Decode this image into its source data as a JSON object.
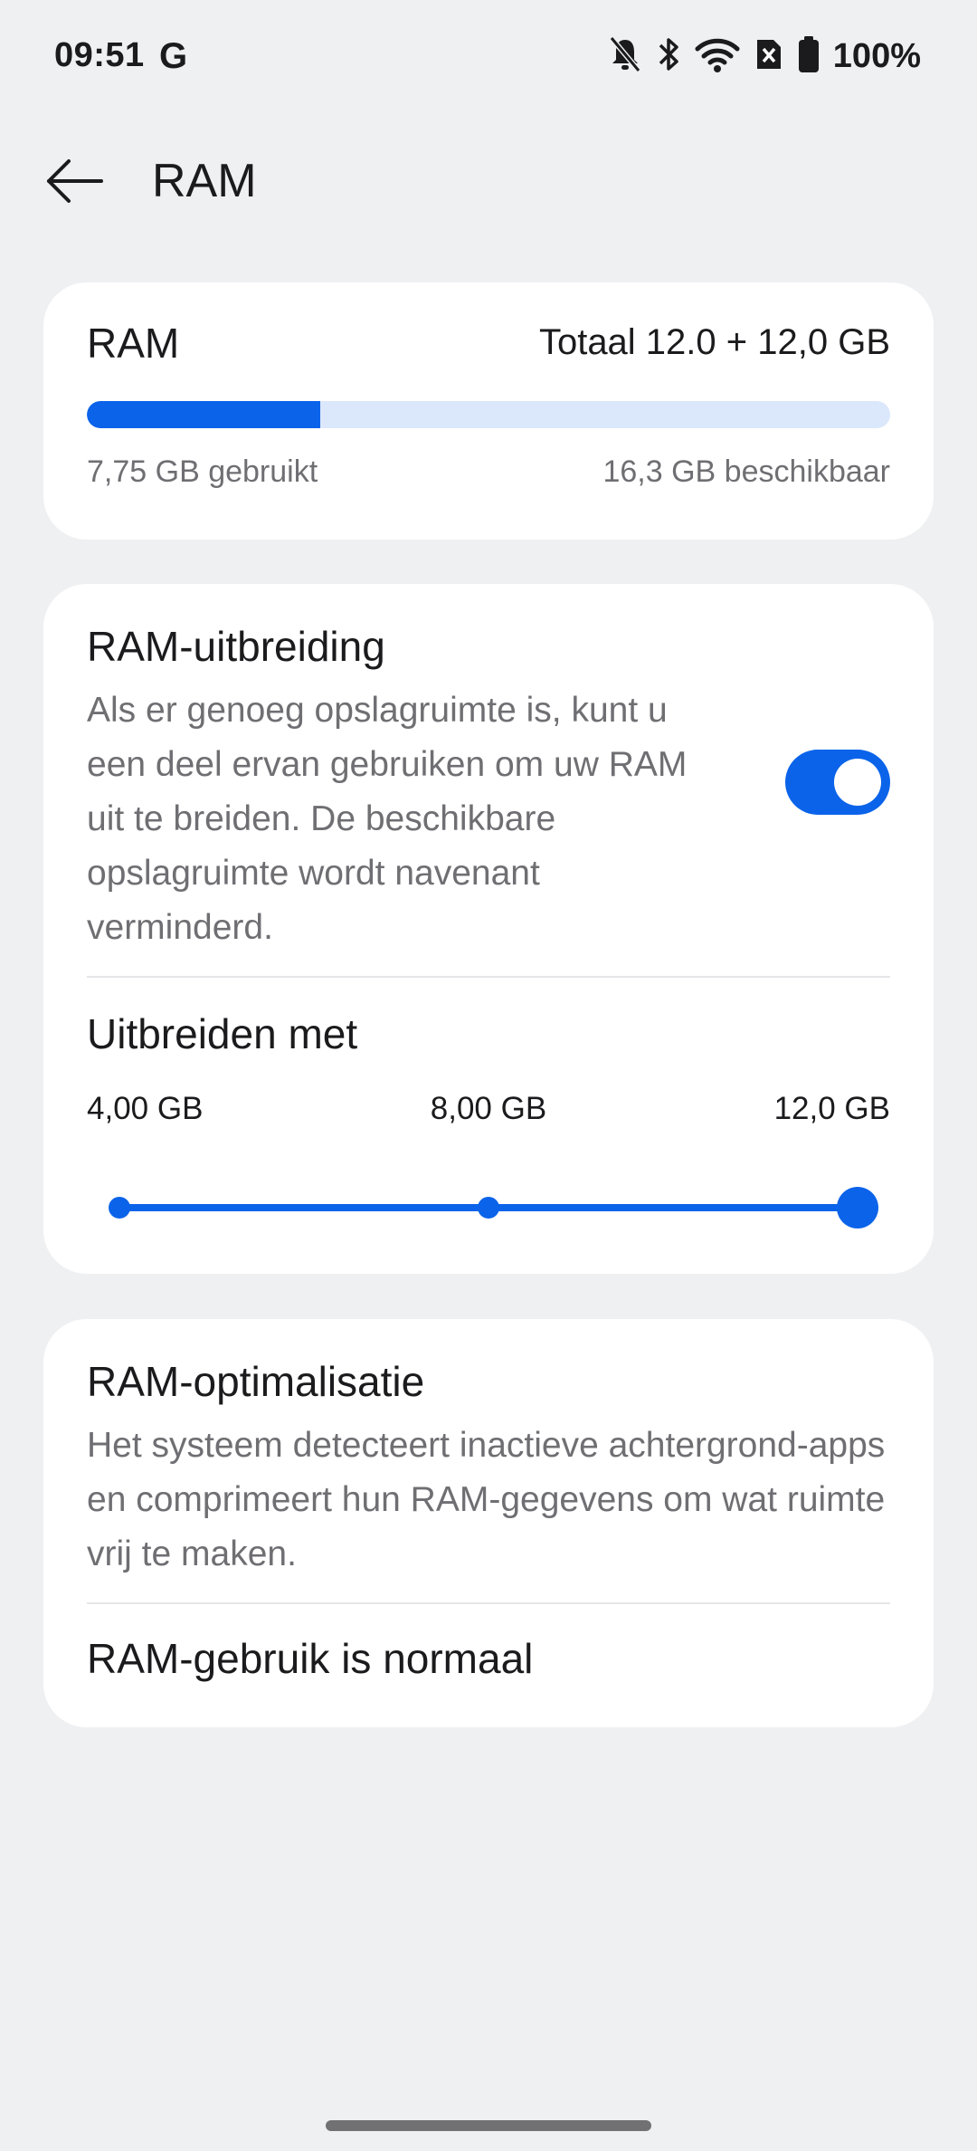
{
  "status_bar": {
    "time": "09:51",
    "google_icon_text": "G",
    "battery_text": "100%",
    "icons": [
      "bell-muted-icon",
      "bluetooth-icon",
      "wifi-icon",
      "no-sim-icon",
      "battery-icon"
    ]
  },
  "header": {
    "title": "RAM",
    "back_icon": "arrow-left-icon"
  },
  "ram_card": {
    "title": "RAM",
    "total": "Totaal 12.0 + 12,0 GB",
    "used": "7,75 GB gebruikt",
    "available": "16,3 GB beschikbaar",
    "usage_fraction": 0.29
  },
  "extension_card": {
    "title": "RAM-uitbreiding",
    "description": "Als er genoeg opslagruimte is, kunt u een deel ervan gebruiken om uw RAM uit te breiden. De beschikbare opslagruimte wordt navenant verminderd.",
    "toggle_on": true,
    "expand_title": "Uitbreiden met",
    "options": [
      "4,00 GB",
      "8,00 GB",
      "12,0 GB"
    ],
    "selected_index": 2
  },
  "optimization_card": {
    "title": "RAM-optimalisatie",
    "description": "Het systeem detecteert inactieve achtergrond-apps en comprimeert hun RAM-gegevens om wat ruimte vrij te maken.",
    "status": "RAM-gebruik is normaal"
  },
  "colors": {
    "accent": "#0b63ea",
    "track_bg": "#dbe7fb",
    "page_bg": "#eff0f2",
    "secondary_text": "#6f6f73"
  }
}
